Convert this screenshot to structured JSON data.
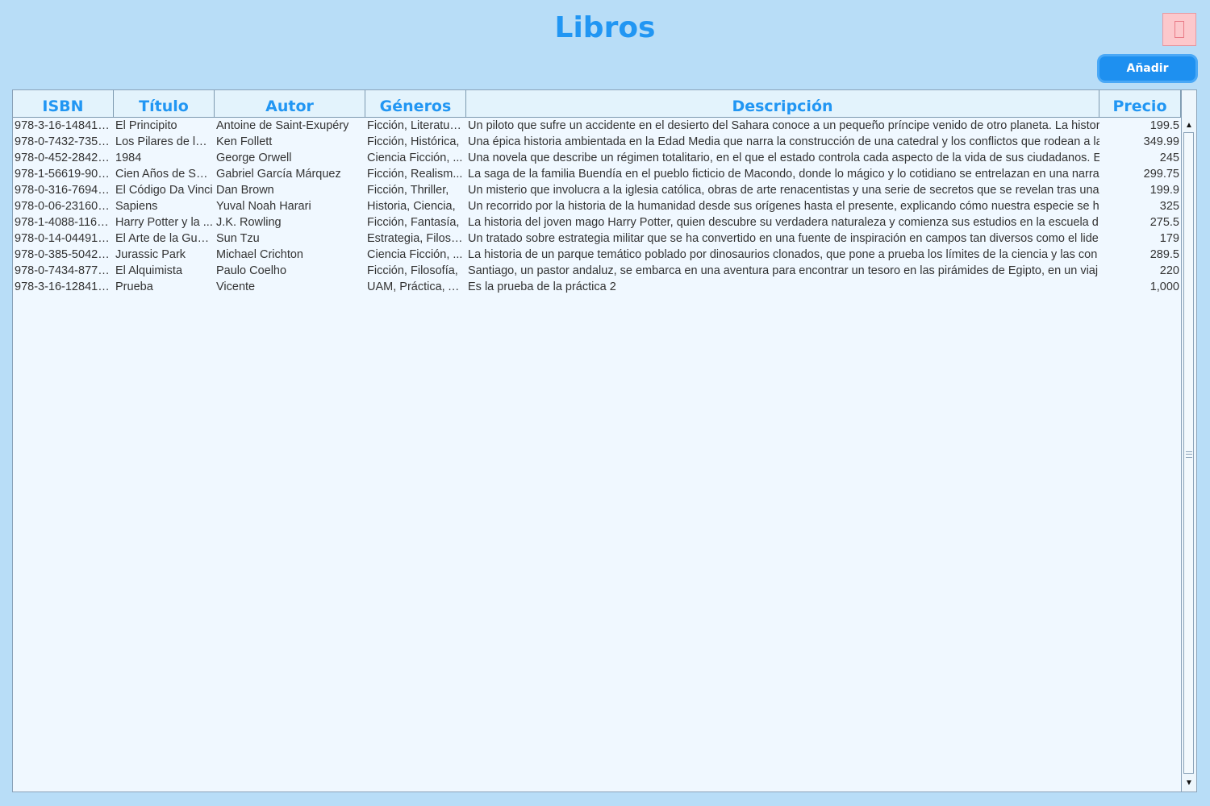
{
  "window": {
    "title": "Libros",
    "add_label": "Añadir"
  },
  "table": {
    "columns": [
      "ISBN",
      "Título",
      "Autor",
      "Géneros",
      "Descripción",
      "Precio"
    ],
    "rows": [
      [
        "978-3-16-148410...",
        "El Principito",
        "Antoine de Saint-Exupéry",
        "Ficción, Literatura...",
        "Un piloto que sufre un accidente en el desierto del Sahara conoce a un pequeño príncipe venido de otro planeta. La histor",
        "199.5"
      ],
      [
        "978-0-7432-7356...",
        "Los Pilares de la ...",
        "Ken Follett",
        "Ficción, Histórica,",
        "Una épica historia ambientada en la Edad Media que narra la construcción de una catedral y los conflictos que rodean a la",
        "349.99"
      ],
      [
        "978-0-452-28423...",
        "1984",
        "George Orwell",
        "Ciencia Ficción, ...",
        "Una novela que describe un régimen totalitario, en el que el estado controla cada aspecto de la vida de sus ciudadanos. E",
        "245"
      ],
      [
        "978-1-56619-909...",
        "Cien Años de Sol...",
        "Gabriel García Márquez",
        "Ficción, Realism...",
        "La saga de la familia Buendía en el pueblo ficticio de Macondo, donde lo mágico y lo cotidiano se entrelazan en una narra",
        "299.75"
      ],
      [
        "978-0-316-76948...",
        "El Código Da Vinci",
        "Dan Brown",
        "Ficción, Thriller,",
        "Un misterio que involucra a la iglesia católica, obras de arte renacentistas y una serie de secretos que se revelan tras una",
        "199.9"
      ],
      [
        "978-0-06-231609...",
        "Sapiens",
        "Yuval Noah Harari",
        "Historia, Ciencia,",
        "Un recorrido por la historia de la humanidad desde sus orígenes hasta el presente, explicando cómo nuestra especie se h",
        "325"
      ],
      [
        "978-1-4088-1162...",
        "Harry Potter y la ...",
        "J.K. Rowling",
        "Ficción, Fantasía,",
        "La historia del joven mago Harry Potter, quien descubre su verdadera naturaleza y comienza sus estudios en la escuela d",
        "275.5"
      ],
      [
        "978-0-14-044913...",
        "El Arte de la Guer...",
        "Sun Tzu",
        "Estrategia, Filoso...",
        "Un tratado sobre estrategia militar que se ha convertido en una fuente de inspiración en campos tan diversos como el lide",
        "179"
      ],
      [
        "978-0-385-50420...",
        "Jurassic Park",
        "Michael Crichton",
        "Ciencia Ficción, ...",
        "La historia de un parque temático poblado por dinosaurios clonados, que pone a prueba los límites de la ciencia y las con",
        "289.5"
      ],
      [
        "978-0-7434-8773...",
        "El Alquimista",
        "Paulo Coelho",
        "Ficción, Filosofía,",
        "Santiago, un pastor andaluz, se embarca en una aventura para encontrar un tesoro en las pirámides de Egipto, en un viaj",
        "220"
      ],
      [
        "978-3-16-128410...",
        "Prueba",
        "Vicente",
        "UAM, Práctica, Al...",
        "Es la prueba de la práctica 2",
        "1,000"
      ]
    ]
  },
  "icons": {
    "close": "close-icon",
    "scroll_up": "arrow-up-icon",
    "scroll_down": "arrow-down-icon"
  },
  "colors": {
    "background": "#b8ddf7",
    "accent": "#2196f3",
    "add_button": "#1e90f0",
    "close_button": "#fcc8cc",
    "table_background": "#f0f8ff",
    "header_background": "#e3f3fc"
  }
}
